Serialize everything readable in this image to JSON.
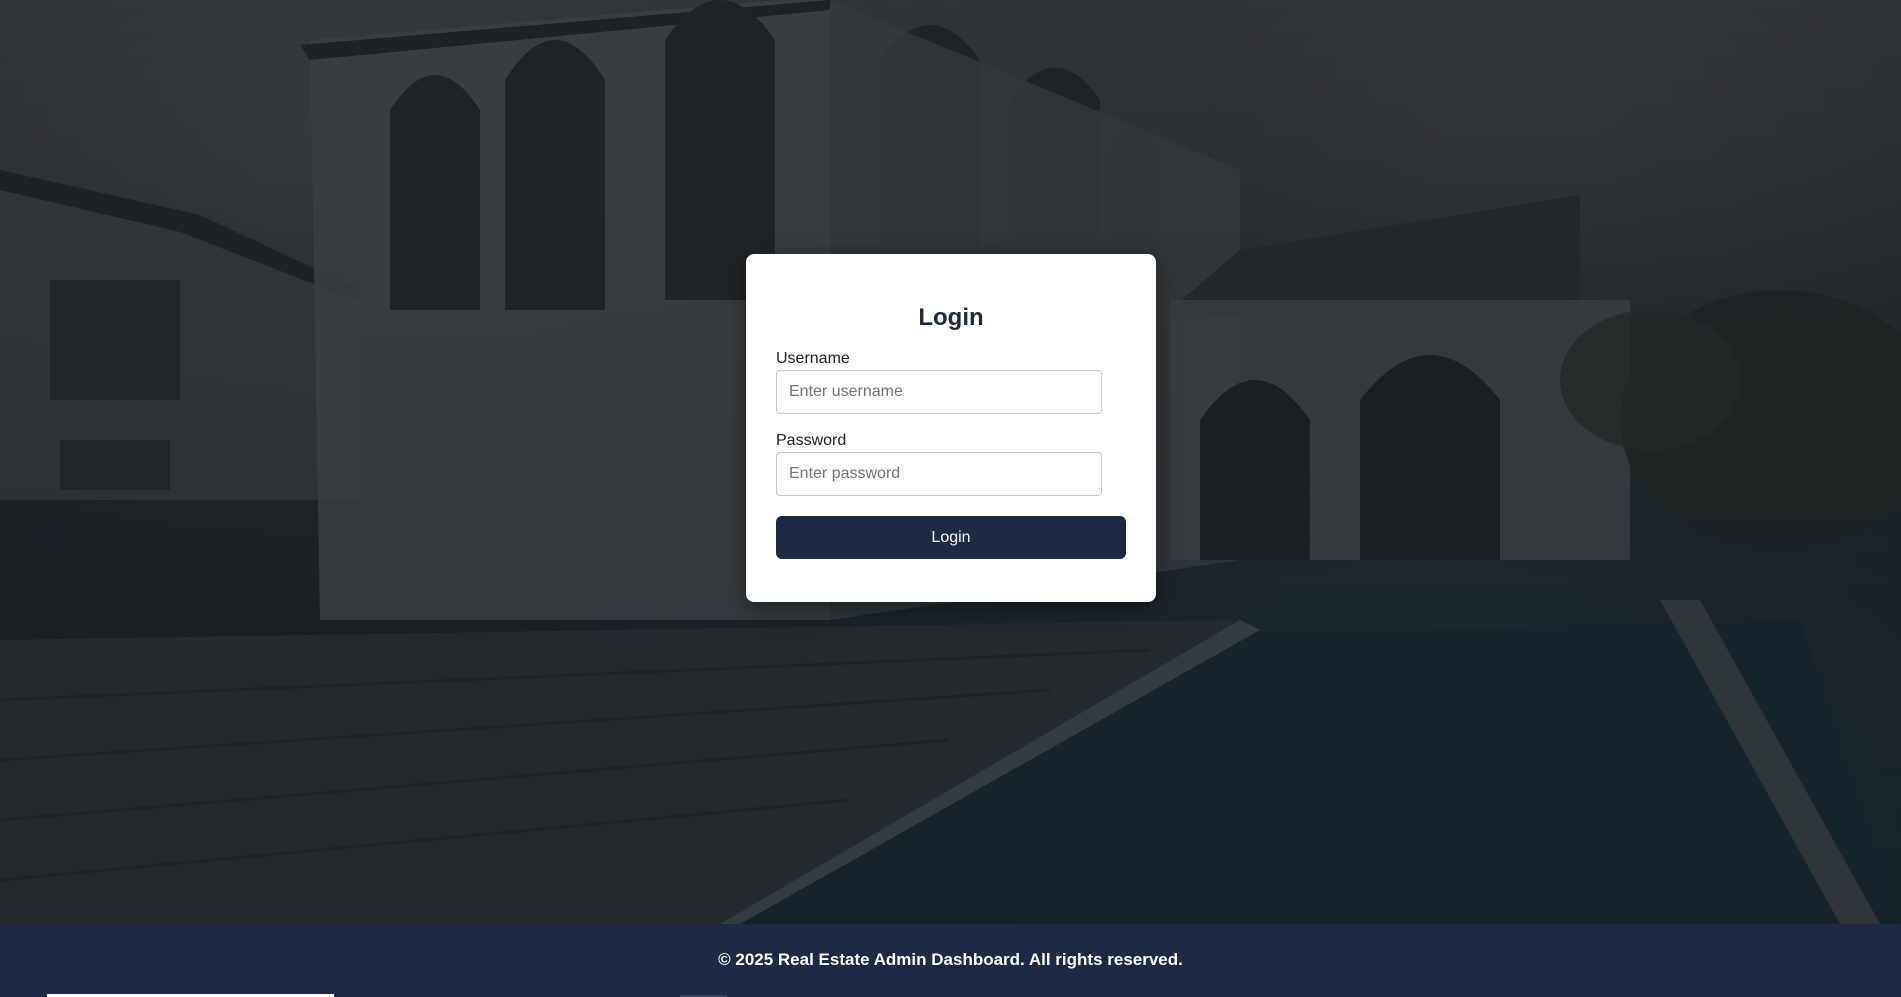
{
  "login": {
    "title": "Login",
    "username_label": "Username",
    "username_placeholder": "Enter username",
    "password_label": "Password",
    "password_placeholder": "Enter password",
    "submit_label": "Login"
  },
  "footer": {
    "text": "© 2025 Real Estate Admin Dashboard. All rights reserved."
  },
  "colors": {
    "primary": "#1e2a44",
    "card_background": "#ffffff"
  }
}
